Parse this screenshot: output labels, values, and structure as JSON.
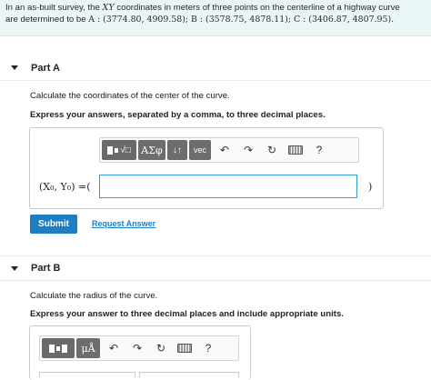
{
  "problem": {
    "line1_pre": "In an as-built survey, the ",
    "line1_var": "XY",
    "line1_post": " coordinates in meters of three points on the centerline of a highway curve",
    "line2_pre": "are determined to be ",
    "line2_math": "A : (3774.80, 4909.58); B : (3578.75, 4878.11); C : (3406.87, 4807.95)."
  },
  "part_a": {
    "title": "Part A",
    "question": "Calculate the coordinates of the center of the curve.",
    "instruction": "Express your answers, separated by a comma, to three decimal places.",
    "toolbar": {
      "greek": "ΑΣφ",
      "arrows": "↓↑",
      "vec": "vec",
      "undo": "↶",
      "redo": "↷",
      "reset": "↻",
      "help": "?"
    },
    "answer_label": "(X₀, Y₀) =(",
    "answer_close": ")",
    "answer_value": "",
    "submit": "Submit",
    "request": "Request Answer"
  },
  "part_b": {
    "title": "Part B",
    "question": "Calculate the radius of the curve.",
    "instruction": "Express your answer to three decimal places and include appropriate units.",
    "toolbar": {
      "units": "μÅ",
      "undo": "↶",
      "redo": "↷",
      "reset": "↻",
      "help": "?"
    }
  }
}
